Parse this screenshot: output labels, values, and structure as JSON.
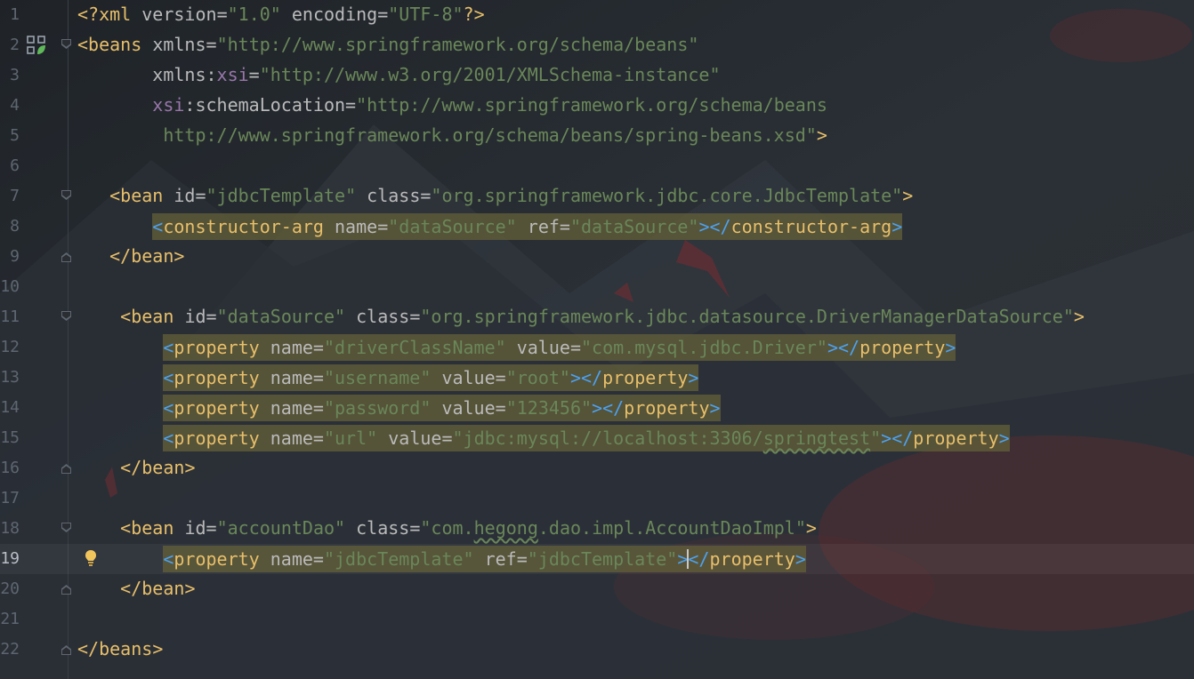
{
  "editor": {
    "current_line": 19,
    "lines": [
      {
        "n": "1"
      },
      {
        "n": "2"
      },
      {
        "n": "3"
      },
      {
        "n": "4"
      },
      {
        "n": "5"
      },
      {
        "n": "6"
      },
      {
        "n": "7"
      },
      {
        "n": "8"
      },
      {
        "n": "9"
      },
      {
        "n": "10"
      },
      {
        "n": "11"
      },
      {
        "n": "12"
      },
      {
        "n": "13"
      },
      {
        "n": "14"
      },
      {
        "n": "15"
      },
      {
        "n": "16"
      },
      {
        "n": "17"
      },
      {
        "n": "18"
      },
      {
        "n": "19"
      },
      {
        "n": "20"
      },
      {
        "n": "21"
      },
      {
        "n": "22"
      }
    ],
    "decl": {
      "open": "<?",
      "name": "xml",
      "a1": "version",
      "v1": "\"1.0\"",
      "a2": "encoding",
      "v2": "\"UTF-8\"",
      "close": "?>"
    },
    "beans_open": {
      "lt": "<",
      "name": "beans",
      "a1": "xmlns",
      "eq": "=",
      "v1": "\"http://www.springframework.org/schema/beans\""
    },
    "line3": {
      "a": "xmlns:",
      "ns": "xsi",
      "eq": "=",
      "v": "\"http://www.w3.org/2001/XMLSchema-instance\""
    },
    "line4": {
      "ns": "xsi",
      "a": ":schemaLocation",
      "eq": "=",
      "v": "\"http://www.springframework.org/schema/beans"
    },
    "line5": {
      "v": "http://www.springframework.org/schema/beans/spring-beans.xsd\"",
      "gt": ">"
    },
    "bean1": {
      "lt": "<",
      "name": "bean",
      "a1": "id",
      "v1": "\"jdbcTemplate\"",
      "a2": "class",
      "v2": "\"org.springframework.jdbc.core.JdbcTemplate\"",
      "gt": ">"
    },
    "ctor": {
      "lt": "<",
      "name": "constructor-arg",
      "a1": "name",
      "v1": "\"dataSource\"",
      "a2": "ref",
      "v2": "\"dataSource\"",
      "mid": "></",
      "endname": "constructor-arg",
      "gt": ">"
    },
    "bean_close": {
      "lt": "</",
      "name": "bean",
      "gt": ">"
    },
    "bean2": {
      "lt": "<",
      "name": "bean",
      "a1": "id",
      "v1": "\"dataSource\"",
      "a2": "class",
      "v2": "\"org.springframework.jdbc.datasource.DriverManagerDataSource\"",
      "gt": ">"
    },
    "props": [
      {
        "lt": "<",
        "name": "property",
        "a1": "name",
        "v1": "\"driverClassName\"",
        "a2": "value",
        "v2": "\"com.mysql.jdbc.Driver\"",
        "mid": "></",
        "endname": "property",
        "gt": ">"
      },
      {
        "lt": "<",
        "name": "property",
        "a1": "name",
        "v1": "\"username\"",
        "a2": "value",
        "v2": "\"root\"",
        "mid": "></",
        "endname": "property",
        "gt": ">"
      },
      {
        "lt": "<",
        "name": "property",
        "a1": "name",
        "v1": "\"password\"",
        "a2": "value",
        "v2": "\"123456\"",
        "mid": "></",
        "endname": "property",
        "gt": ">"
      },
      {
        "lt": "<",
        "name": "property",
        "a1": "name",
        "v1": "\"url\"",
        "a2": "value",
        "v2a": "\"jdbc:mysql://localhost:3306/",
        "v2b": "springtest",
        "v2c": "\"",
        "mid": "></",
        "endname": "property",
        "gt": ">"
      }
    ],
    "bean3": {
      "lt": "<",
      "name": "bean",
      "a1": "id",
      "v1": "\"accountDao\"",
      "a2": "class",
      "v2a": "\"com.",
      "v2b": "hegong",
      "v2c": ".dao.impl.AccountDaoImpl\"",
      "gt": ">"
    },
    "prop19": {
      "lt": "<",
      "name": "property",
      "a1": "name",
      "v1": "\"jdbcTemplate\"",
      "a2": "ref",
      "v2": "\"jdbcTemplate\"",
      "gt1": ">",
      "mid": "</",
      "endname": "property",
      "gt": ">"
    },
    "beans_close": {
      "lt": "</",
      "name": "beans",
      "gt": ">"
    }
  },
  "colors": {
    "tag": "#e8bf6a",
    "attr": "#bababa",
    "value": "#6a8759",
    "namespace": "#9876aa",
    "bracket_blue": "#4ca1f0",
    "background": "#22262b"
  }
}
